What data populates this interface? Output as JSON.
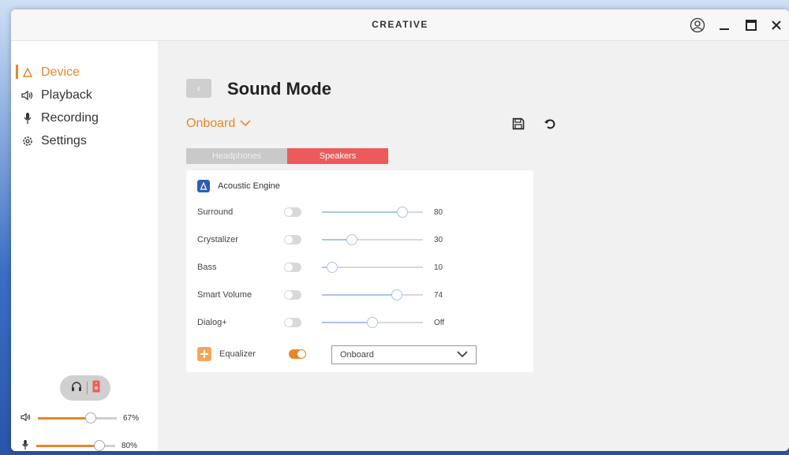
{
  "app": {
    "brand": "CREATIVE"
  },
  "window_controls": {
    "account_icon": "account-icon",
    "minimize": "—",
    "maximize": "☐",
    "close": "×"
  },
  "sidebar": {
    "items": [
      {
        "label": "Device",
        "icon": "device-icon",
        "active": true
      },
      {
        "label": "Playback",
        "icon": "speaker-icon",
        "active": false
      },
      {
        "label": "Recording",
        "icon": "microphone-icon",
        "active": false
      },
      {
        "label": "Settings",
        "icon": "gear-icon",
        "active": false
      }
    ],
    "volume": {
      "percent_label": "67%",
      "level": 0.67
    },
    "mic": {
      "percent_label": "80%",
      "level": 0.8
    }
  },
  "main": {
    "title": "Sound Mode",
    "back_label": "‹",
    "device_select": "Onboard",
    "tabs": [
      {
        "label": "Headphones",
        "active": false
      },
      {
        "label": "Speakers",
        "active": true
      }
    ],
    "panel": {
      "header": "Acoustic Engine",
      "rows": [
        {
          "label": "Surround",
          "value": "80",
          "level": 0.8,
          "enabled": false
        },
        {
          "label": "Crystalizer",
          "value": "30",
          "level": 0.3,
          "enabled": false
        },
        {
          "label": "Bass",
          "value": "10",
          "level": 0.1,
          "enabled": false
        },
        {
          "label": "Smart Volume",
          "value": "74",
          "level": 0.74,
          "enabled": false
        },
        {
          "label": "Dialog+",
          "value": "Off",
          "level": 0.5,
          "enabled": false
        }
      ],
      "equalizer": {
        "label": "Equalizer",
        "enabled": true,
        "preset": "Onboard"
      }
    }
  },
  "colors": {
    "accent": "#e8862a",
    "speakers_tab": "#ec5a5a",
    "slider": "#aac4ea"
  }
}
